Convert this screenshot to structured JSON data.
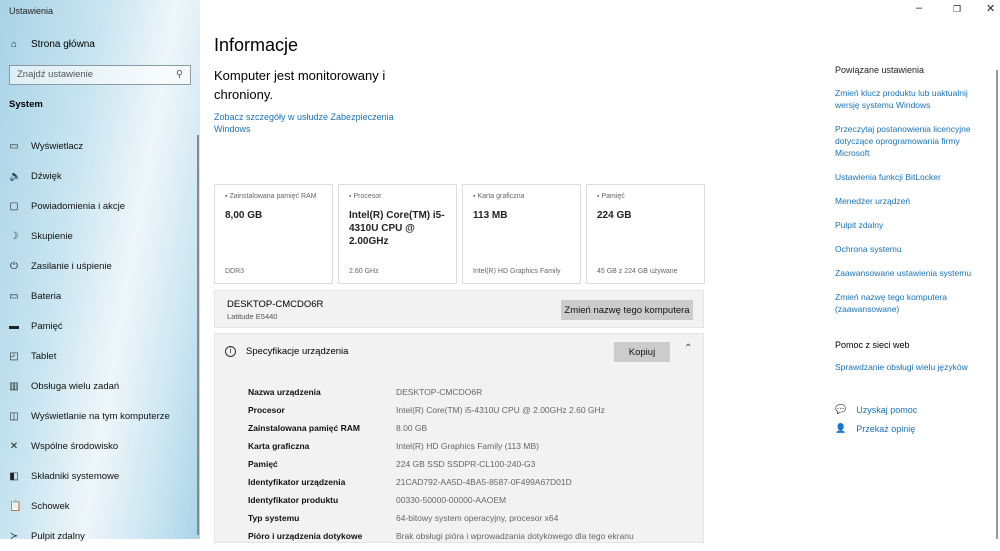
{
  "app_title": "Ustawienia",
  "sidebar": {
    "home": "Strona główna",
    "search_placeholder": "Znajdź ustawienie",
    "section": "System",
    "items": [
      {
        "label": "Wyświetlacz",
        "icon": "monitor-icon"
      },
      {
        "label": "Dźwięk",
        "icon": "speaker-icon"
      },
      {
        "label": "Powiadomienia i akcje",
        "icon": "notification-icon"
      },
      {
        "label": "Skupienie",
        "icon": "moon-icon"
      },
      {
        "label": "Zasilanie i uśpienie",
        "icon": "power-icon"
      },
      {
        "label": "Bateria",
        "icon": "battery-icon"
      },
      {
        "label": "Pamięć",
        "icon": "storage-icon"
      },
      {
        "label": "Tablet",
        "icon": "tablet-icon"
      },
      {
        "label": "Obsługa wielu zadań",
        "icon": "multitasking-icon"
      },
      {
        "label": "Wyświetlanie na tym komputerze",
        "icon": "projecting-icon"
      },
      {
        "label": "Wspólne środowisko",
        "icon": "shared-experiences-icon"
      },
      {
        "label": "Składniki systemowe",
        "icon": "components-icon"
      },
      {
        "label": "Schowek",
        "icon": "clipboard-icon"
      },
      {
        "label": "Pulpit zdalny",
        "icon": "remote-desktop-icon"
      }
    ]
  },
  "main": {
    "title": "Informacje",
    "monitor_text": "Komputer jest monitorowany i chroniony.",
    "details_link": "Zobacz szczegóły w usłudze Zabezpieczenia Windows",
    "cards": [
      {
        "label": "Zainstalowana pamięć RAM",
        "value": "8,00 GB",
        "sub": "DDR3"
      },
      {
        "label": "Procesor",
        "value": "Intel(R) Core(TM) i5-4310U CPU @ 2.00GHz",
        "sub": "2.60 GHz"
      },
      {
        "label": "Karta graficzna",
        "value": "113 MB",
        "sub": "Intel(R) HD Graphics Family"
      },
      {
        "label": "Pamięć",
        "value": "224 GB",
        "sub": "45 GB z 224 GB używane"
      }
    ],
    "device_name": "DESKTOP-CMCDO6R",
    "device_model": "Latitude E5440",
    "rename_button": "Zmień nazwę tego komputera",
    "spec_title": "Specyfikacje urządzenia",
    "copy_button": "Kopiuj",
    "specs": [
      {
        "k": "Nazwa urządzenia",
        "v": "DESKTOP-CMCDO6R"
      },
      {
        "k": "Procesor",
        "v": "Intel(R) Core(TM) i5-4310U CPU @ 2.00GHz   2.60 GHz"
      },
      {
        "k": "Zainstalowana pamięć RAM",
        "v": "8.00 GB"
      },
      {
        "k": "Karta graficzna",
        "v": "Intel(R) HD Graphics Family (113 MB)"
      },
      {
        "k": "Pamięć",
        "v": "224 GB SSD SSDPR-CL100-240-G3"
      },
      {
        "k": "Identyfikator urządzenia",
        "v": "21CAD792-AA5D-4BA5-8587-0F499A67D01D"
      },
      {
        "k": "Identyfikator produktu",
        "v": "00330-50000-00000-AAOEM"
      },
      {
        "k": "Typ systemu",
        "v": "64-bitowy system operacyjny, procesor x64"
      },
      {
        "k": "Pióro i urządzenia dotykowe",
        "v": "Brak obsługi pióra i wprowadzania dotykowego dla tego ekranu"
      }
    ]
  },
  "related": {
    "title": "Powiązane ustawienia",
    "links": [
      "Zmień klucz produktu lub uaktualnij wersję systemu Windows",
      "Przeczytaj postanowienia licencyjne dotyczące oprogramowania firmy Microsoft",
      "Ustawienia funkcji BitLocker",
      "Menedżer urządzeń",
      "Pulpit zdalny",
      "Ochrona systemu",
      "Zaawansowane ustawienia systemu",
      "Zmień nazwę tego komputera (zaawansowane)"
    ]
  },
  "web_help": {
    "title": "Pomoc z sieci web",
    "link": "Sprawdzanie obsługi wielu języków"
  },
  "help": {
    "get_help": "Uzyskaj pomoc",
    "feedback": "Przekaż opinię"
  }
}
